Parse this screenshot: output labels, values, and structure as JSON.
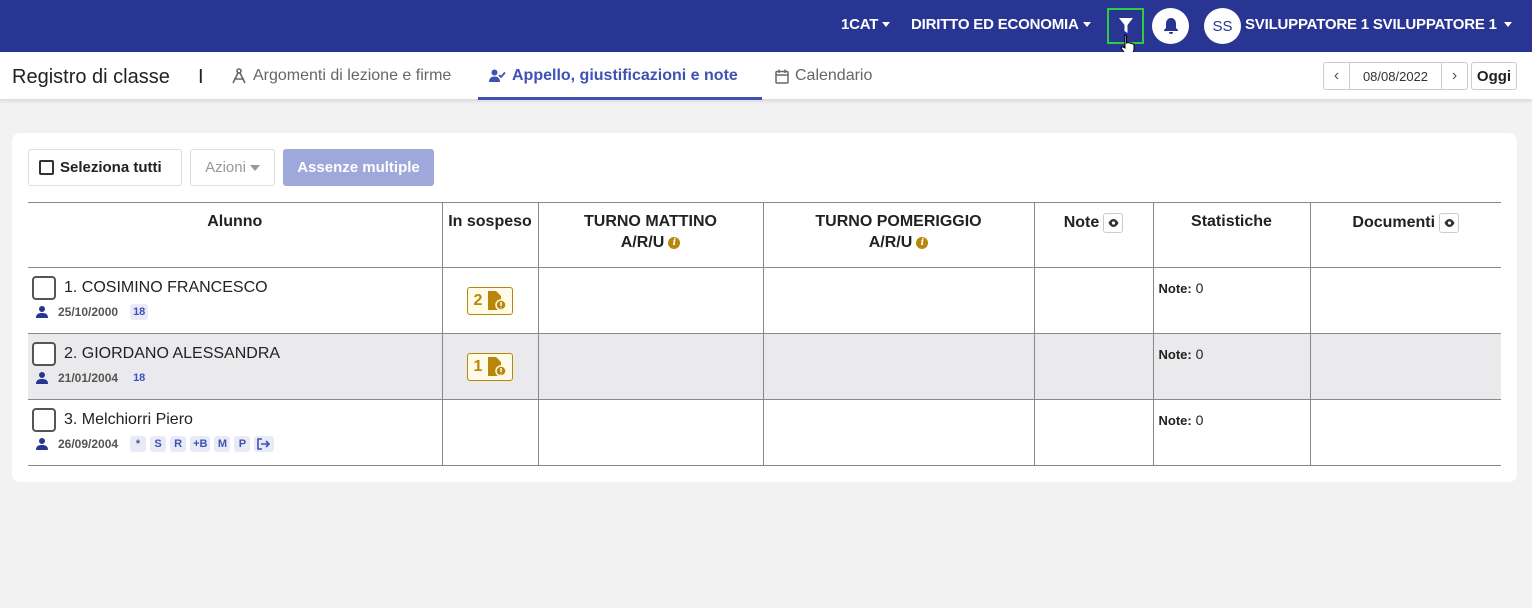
{
  "topbar": {
    "class_label": "1CAT",
    "subject_label": "DIRITTO ED ECONOMIA",
    "avatar_initials": "SS",
    "user_name": "SVILUPPATORE 1 SVILUPPATORE 1",
    "filter_icon": "filter-icon",
    "bell_icon": "bell-icon"
  },
  "subbar": {
    "page_title": "Registro di classe",
    "separator": "I",
    "tabs": [
      {
        "label": "Argomenti di lezione e firme",
        "icon": "compass-icon"
      },
      {
        "label": "Appello, giustificazioni e note",
        "icon": "user-check-icon",
        "active": true
      },
      {
        "label": "Calendario",
        "icon": "calendar-icon"
      }
    ],
    "date": "08/08/2022",
    "today_label": "Oggi"
  },
  "toolbar": {
    "select_all_label": "Seleziona tutti",
    "actions_label": "Azioni",
    "multiple_absences_label": "Assenze multiple"
  },
  "table": {
    "headers": {
      "alunno": "Alunno",
      "sospeso": "In sospeso",
      "mattino": "TURNO MATTINO",
      "mattino_sub": "A/R/U",
      "pomeriggio": "TURNO POMERIGGIO",
      "pomeriggio_sub": "A/R/U",
      "note": "Note",
      "statistiche": "Statistiche",
      "documenti": "Documenti"
    },
    "rows": [
      {
        "name": "1. COSIMINO FRANCESCO",
        "dob": "25/10/2000",
        "badges": [
          "18"
        ],
        "pending": "2",
        "stat_label": "Note:",
        "stat_value": "0"
      },
      {
        "name": "2. GIORDANO ALESSANDRA",
        "dob": "21/01/2004",
        "badges": [
          "18"
        ],
        "pending": "1",
        "stat_label": "Note:",
        "stat_value": "0"
      },
      {
        "name": "3. Melchiorri Piero",
        "dob": "26/09/2004",
        "badges": [
          "*",
          "S",
          "R",
          "+B",
          "M",
          "P"
        ],
        "pending": "",
        "stat_label": "Note:",
        "stat_value": "0"
      }
    ]
  },
  "colors": {
    "topbar_bg": "#283593",
    "accent": "#3f51b5",
    "pending": "#b8860b",
    "highlight": "#2ecc40"
  }
}
